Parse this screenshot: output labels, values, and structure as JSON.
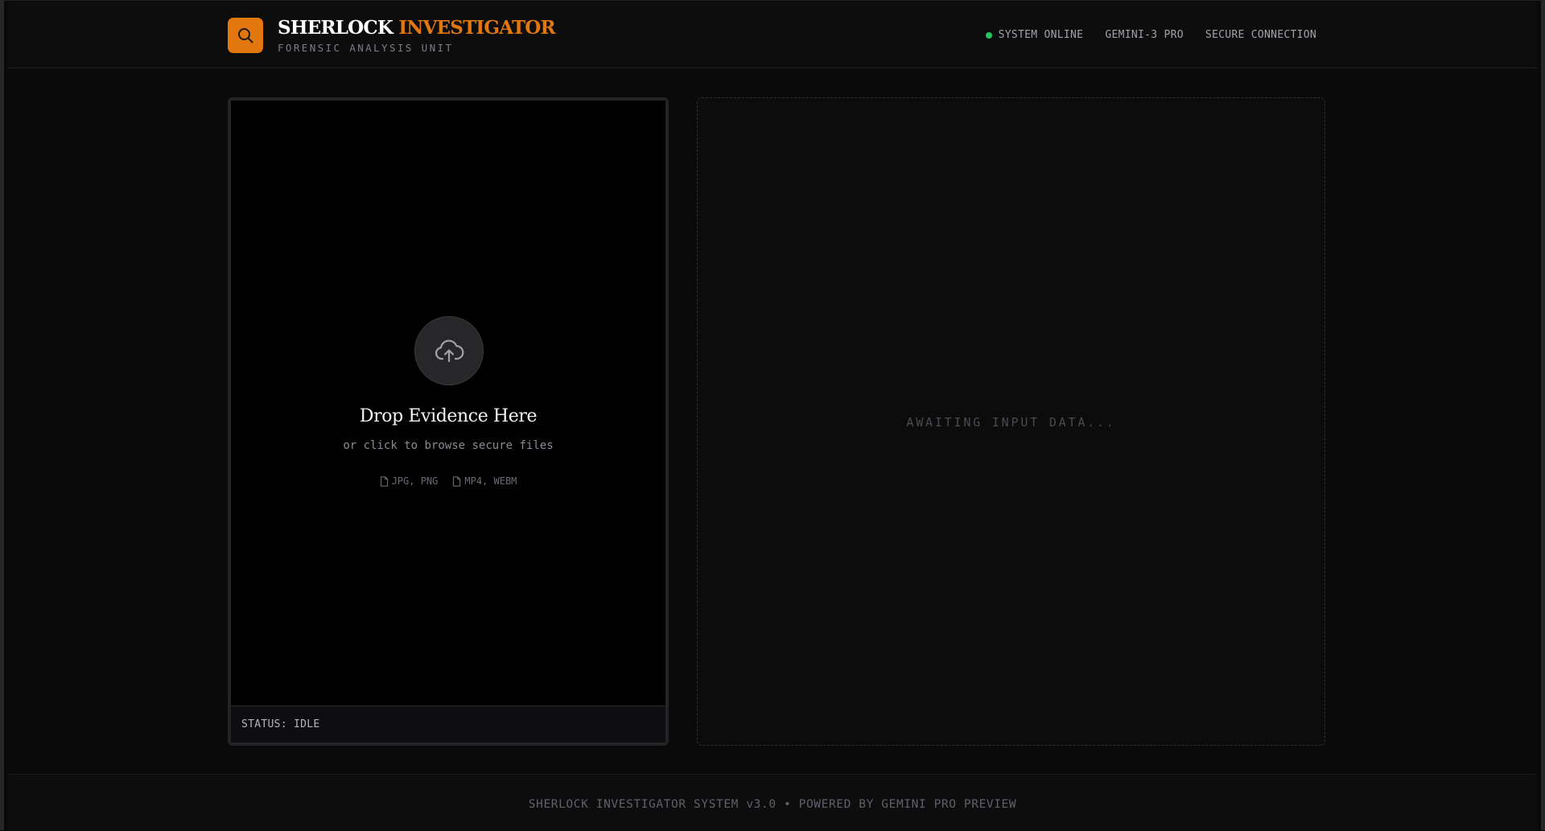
{
  "header": {
    "logo_icon": "search-icon",
    "title_part1": "SHERLOCK",
    "title_part2": "INVESTIGATOR",
    "subtitle": "FORENSIC ANALYSIS UNIT",
    "status_items": {
      "online": "SYSTEM ONLINE",
      "model": "GEMINI-3 PRO",
      "connection": "SECURE CONNECTION"
    },
    "online_color": "#22c55e"
  },
  "upload": {
    "icon": "cloud-upload-icon",
    "title": "Drop Evidence Here",
    "subtitle": "or click to browse secure files",
    "file_types": [
      {
        "icon": "file-icon",
        "label": "JPG, PNG"
      },
      {
        "icon": "file-icon",
        "label": "MP4, WEBM"
      }
    ],
    "status": "STATUS: IDLE"
  },
  "output": {
    "placeholder": "AWAITING INPUT DATA..."
  },
  "footer": {
    "text": "SHERLOCK INVESTIGATOR SYSTEM v3.0 • POWERED BY GEMINI PRO PREVIEW"
  },
  "colors": {
    "accent": "#e2760f",
    "background": "#0a0a0a"
  }
}
